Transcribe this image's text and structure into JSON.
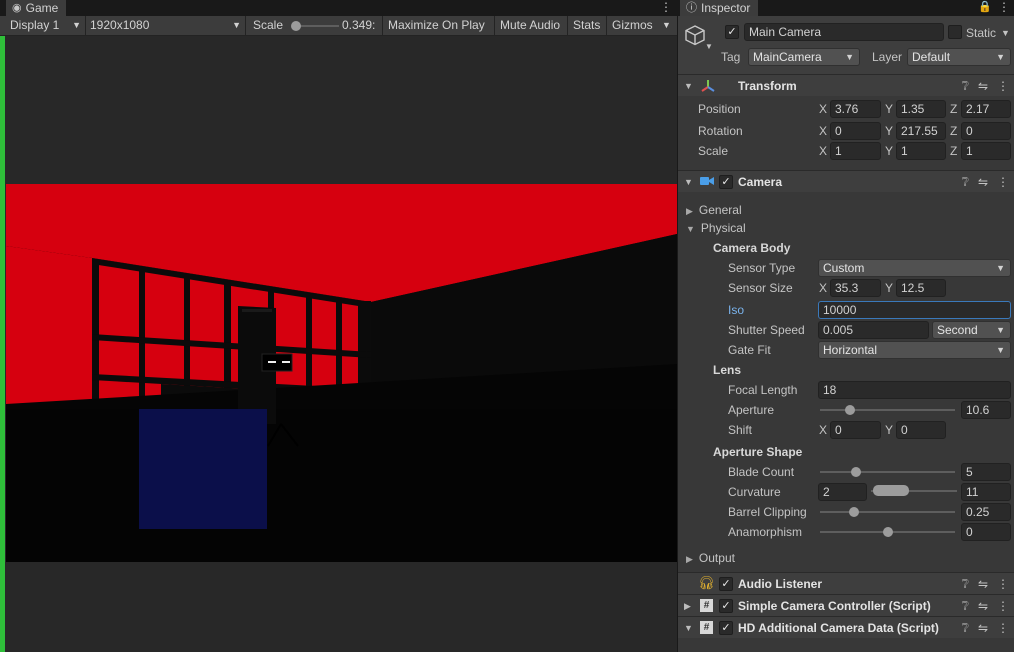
{
  "game": {
    "tab_label": "Game",
    "display": "Display 1",
    "resolution": "1920x1080",
    "scale_label": "Scale",
    "scale_value": "0.349:",
    "buttons": [
      "Maximize On Play",
      "Mute Audio",
      "Stats",
      "Gizmos"
    ]
  },
  "inspector": {
    "tab_label": "Inspector",
    "object_name": "Main Camera",
    "static_label": "Static",
    "tag_label": "Tag",
    "tag_value": "MainCamera",
    "layer_label": "Layer",
    "layer_value": "Default"
  },
  "transform": {
    "title": "Transform",
    "rows": [
      {
        "label": "Position",
        "x": "3.76",
        "y": "1.35",
        "z": "2.17"
      },
      {
        "label": "Rotation",
        "x": "0",
        "y": "217.55",
        "z": "0"
      },
      {
        "label": "Scale",
        "x": "1",
        "y": "1",
        "z": "1"
      }
    ]
  },
  "camera": {
    "title": "Camera",
    "general_label": "General",
    "physical_label": "Physical",
    "camera_body_label": "Camera Body",
    "sensor_type_label": "Sensor Type",
    "sensor_type_value": "Custom",
    "sensor_size_label": "Sensor Size",
    "sensor_size_x": "35.3",
    "sensor_size_y": "12.5",
    "iso_label": "Iso",
    "iso_value": "10000",
    "shutter_speed_label": "Shutter Speed",
    "shutter_speed_value": "0.005",
    "shutter_unit": "Second",
    "gate_fit_label": "Gate Fit",
    "gate_fit_value": "Horizontal",
    "lens_label": "Lens",
    "focal_length_label": "Focal Length",
    "focal_length_value": "18",
    "aperture_label": "Aperture",
    "aperture_value": "10.6",
    "aperture_slider": 0.22,
    "shift_label": "Shift",
    "shift_x": "0",
    "shift_y": "0",
    "aperture_shape_label": "Aperture Shape",
    "blade_count_label": "Blade Count",
    "blade_count_value": "5",
    "blade_count_slider": 0.27,
    "curvature_label": "Curvature",
    "curvature_min": "2",
    "curvature_max": "11",
    "barrel_clipping_label": "Barrel Clipping",
    "barrel_clipping_value": "0.25",
    "barrel_clipping_slider": 0.25,
    "anamorphism_label": "Anamorphism",
    "anamorphism_value": "0",
    "anamorphism_slider": 0.5,
    "output_label": "Output"
  },
  "components": [
    {
      "title": "Audio Listener"
    },
    {
      "title": "Simple Camera Controller (Script)"
    },
    {
      "title": "HD Additional Camera Data (Script)"
    }
  ],
  "axes": {
    "x": "X",
    "y": "Y",
    "z": "Z"
  },
  "colors": {
    "viewport_red": "#d6000f",
    "play_mode_green": "#2fbf3a",
    "focus_blue": "#3a79bb"
  }
}
